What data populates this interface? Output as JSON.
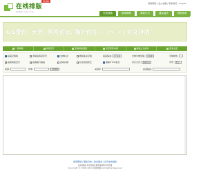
{
  "header": {
    "logo_text": "在线排版",
    "logo_sub": "paiban.xxxx.com",
    "beta_label": "测试版",
    "top_links": "使用帮助 | 加入收藏 | 联系我们 | English"
  },
  "nav": {
    "tabs": [
      {
        "label": "在线排版",
        "active": true
      },
      {
        "label": "使用帮助",
        "active": false
      },
      {
        "label": "更新日志",
        "active": false
      },
      {
        "label": "建议留言",
        "active": false
      },
      {
        "label": "联系我们",
        "active": false
      }
    ]
  },
  "banner": {
    "text": "GG爱你, 天涯, 网易论坛, 猫扑你在... (>_<) 好文排版"
  },
  "toolbar": {
    "buttons": [
      {
        "label": "一键排版",
        "icon": "magic-icon"
      },
      {
        "label": "清除空行",
        "icon": "eraser-icon"
      },
      {
        "label": "复制排版结果",
        "icon": "copy-icon"
      },
      {
        "label": "清空所有内容",
        "icon": "trash-icon"
      },
      {
        "label": "撤销上次操作",
        "icon": "undo-icon"
      },
      {
        "label": "更多设置",
        "icon": "gear-icon"
      }
    ]
  },
  "options": {
    "row1": {
      "opt1": "段首空两格",
      "opt2": "清除段落间空行",
      "opt3": "全角标点",
      "opt4": "删除多余空格",
      "indent_label": "段首缩进:",
      "indent_value": "2个字符",
      "font_label": "全角半角处理:",
      "font_value": "不处理",
      "color_label": "字体颜色:"
    },
    "row2": {
      "opt1": "段落间加空行",
      "opt2": "段落首行缩进",
      "opt3": "自动纠错",
      "opt4": "标点自动修正",
      "opt5": "保留HTML格式",
      "align_label": "对齐方式:",
      "align_value": "两端对齐",
      "size_label": "字号:",
      "size_value": "默认"
    },
    "row3": {
      "title_label": "标题:",
      "author_label": "作者:",
      "upload_label": "上传附件",
      "keyword_label": "关键字:",
      "source_label": "来源链接:"
    }
  },
  "editor": {
    "placeholder": ""
  },
  "footer": {
    "links": "使用帮助 | 更新日志 | 建议留言 | 关于在线排版",
    "line2": "在线排版 免费使用 推荐使用IE浏览器",
    "copyright": "Copyright © 2008-2010 在线排版 All Rights Reserved"
  }
}
